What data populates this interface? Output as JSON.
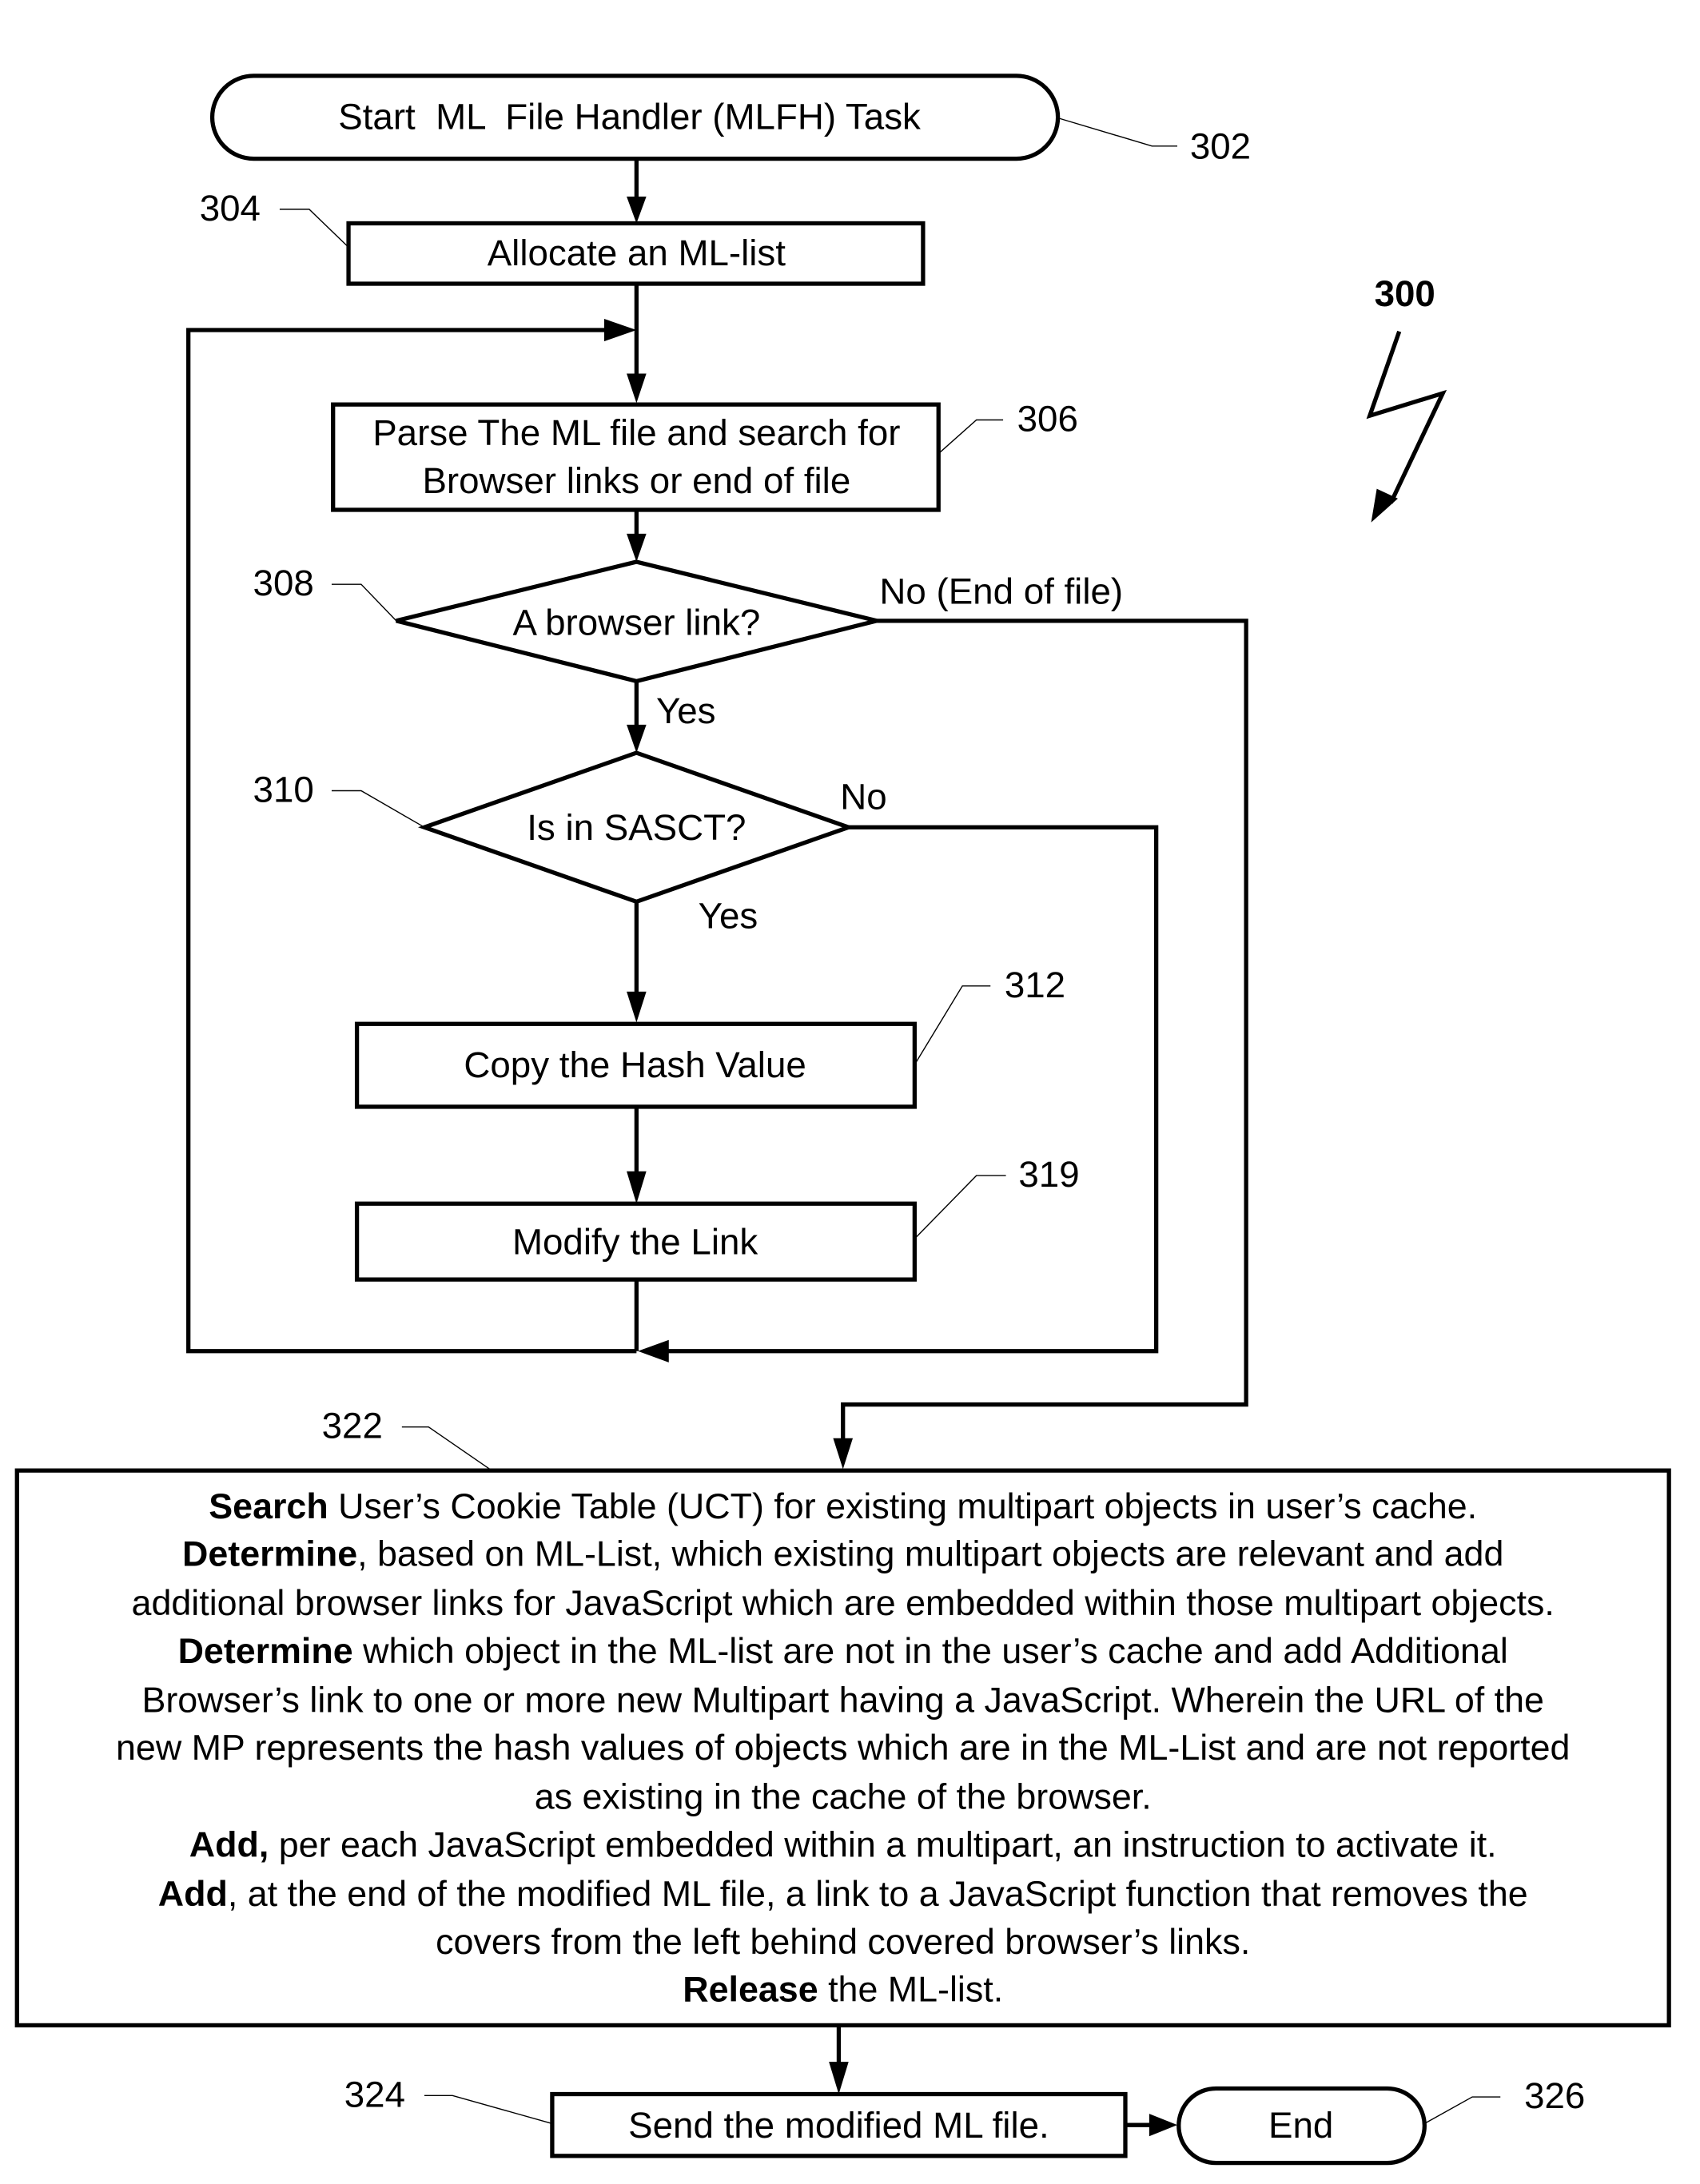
{
  "figure": {
    "number": "300",
    "type": "flowchart"
  },
  "nodes": {
    "start": {
      "ref": "302",
      "label": "Start  ML  File Handler (MLFH) Task"
    },
    "allocate": {
      "ref": "304",
      "label": "Allocate an ML-list"
    },
    "parse": {
      "ref": "306",
      "lines": [
        "Parse The ML file and search for",
        "Browser links or end of file"
      ]
    },
    "is_link": {
      "ref": "308",
      "label": "A browser link?"
    },
    "in_sasct": {
      "ref": "310",
      "label": "Is in SASCT?"
    },
    "copy_hash": {
      "ref": "312",
      "label": "Copy the Hash Value"
    },
    "modify_link": {
      "ref": "319",
      "label": "Modify the Link"
    },
    "process": {
      "ref": "322",
      "lines": [
        {
          "bold": "Search",
          "rest": " User’s Cookie Table (UCT) for existing multipart objects in user’s cache."
        },
        {
          "bold": "Determine",
          "rest": ", based on ML-List, which existing multipart objects are relevant and add"
        },
        {
          "bold": "",
          "rest": "additional browser links for JavaScript which are embedded within those multipart objects."
        },
        {
          "bold": "Determine",
          "rest": " which object in the ML-list are not in the user’s cache and add Additional"
        },
        {
          "bold": "",
          "rest": "Browser’s link to one or more new Multipart having a JavaScript. Wherein the URL of the"
        },
        {
          "bold": "",
          "rest": "new MP represents the hash values of objects which are in the ML-List and are not reported"
        },
        {
          "bold": "",
          "rest": "as existing in the cache of the browser."
        },
        {
          "bold": "Add,",
          "rest": " per each JavaScript embedded within a multipart, an instruction to activate it."
        },
        {
          "bold": "Add",
          "rest": ", at the end of the modified ML file, a link to a JavaScript function that removes the"
        },
        {
          "bold": "",
          "rest": "covers from the left behind covered browser’s links."
        },
        {
          "bold": "Release",
          "rest": " the ML-list."
        }
      ]
    },
    "send": {
      "ref": "324",
      "label": "Send the modified ML file."
    },
    "end": {
      "ref": "326",
      "label": "End"
    }
  },
  "edges": {
    "is_link_no": "No (End of file)",
    "is_link_yes": "Yes",
    "in_sasct_no": "No",
    "in_sasct_yes": "Yes"
  }
}
